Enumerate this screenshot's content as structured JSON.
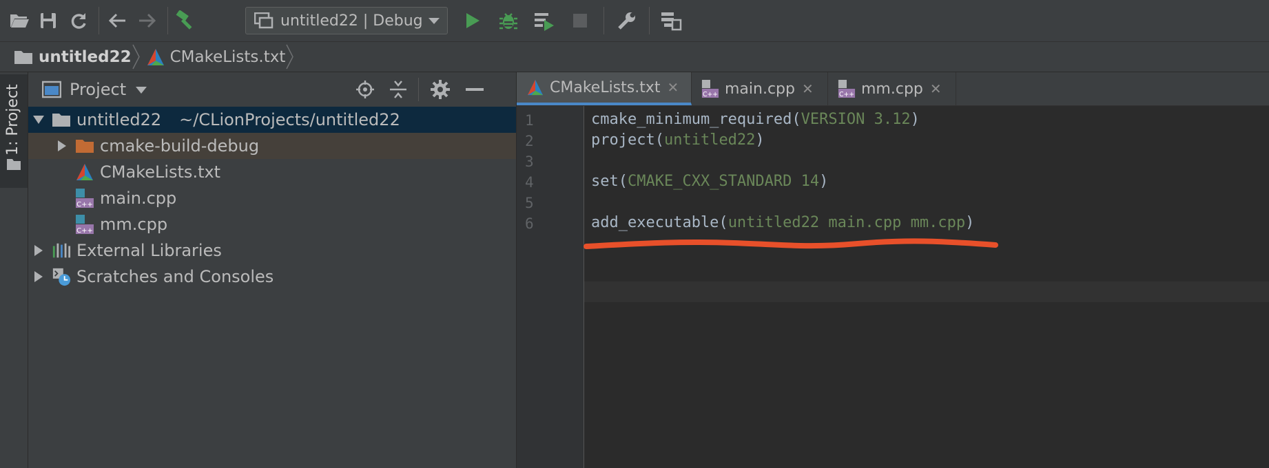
{
  "toolbar": {
    "run_config": "untitled22 | Debug",
    "icons": [
      "open-folder-icon",
      "save-icon",
      "sync-icon",
      "back-arrow-icon",
      "forward-arrow-icon",
      "build-hammer-icon",
      "run-icon",
      "debug-bug-icon",
      "run-coverage-icon",
      "stop-icon",
      "wrench-settings-icon",
      "project-structure-icon"
    ]
  },
  "breadcrumb": {
    "items": [
      {
        "label": "untitled22",
        "icon": "folder-icon"
      },
      {
        "label": "CMakeLists.txt",
        "icon": "cmake-icon"
      }
    ]
  },
  "side_tab": {
    "label": "1: Project"
  },
  "project_panel": {
    "title": "Project",
    "tree": [
      {
        "label": "untitled22",
        "path": "~/CLionProjects/untitled22"
      },
      {
        "label": "cmake-build-debug"
      },
      {
        "label": "CMakeLists.txt"
      },
      {
        "label": "main.cpp"
      },
      {
        "label": "mm.cpp"
      },
      {
        "label": "External Libraries"
      },
      {
        "label": "Scratches and Consoles"
      }
    ]
  },
  "editor": {
    "tabs": [
      {
        "label": "CMakeLists.txt",
        "active": true
      },
      {
        "label": "main.cpp",
        "active": false
      },
      {
        "label": "mm.cpp",
        "active": false
      }
    ],
    "line_numbers": [
      "1",
      "2",
      "3",
      "4",
      "5",
      "6"
    ],
    "lines": [
      {
        "fn": "cmake_minimum_required(",
        "arg": "VERSION 3.12",
        "close": ")"
      },
      {
        "fn": "project(",
        "arg": "untitled22",
        "close": ")"
      },
      {
        "fn": "",
        "arg": "",
        "close": ""
      },
      {
        "fn": "set(",
        "arg": "CMAKE_CXX_STANDARD 14",
        "close": ")"
      },
      {
        "fn": "",
        "arg": "",
        "close": ""
      },
      {
        "fn": "add_executable(",
        "arg": "untitled22 main.cpp mm.cpp",
        "close": ")"
      }
    ]
  },
  "colors": {
    "annotation_underline": "#e8502a",
    "run_green": "#499c54",
    "tab_accent": "#4a88c7"
  }
}
